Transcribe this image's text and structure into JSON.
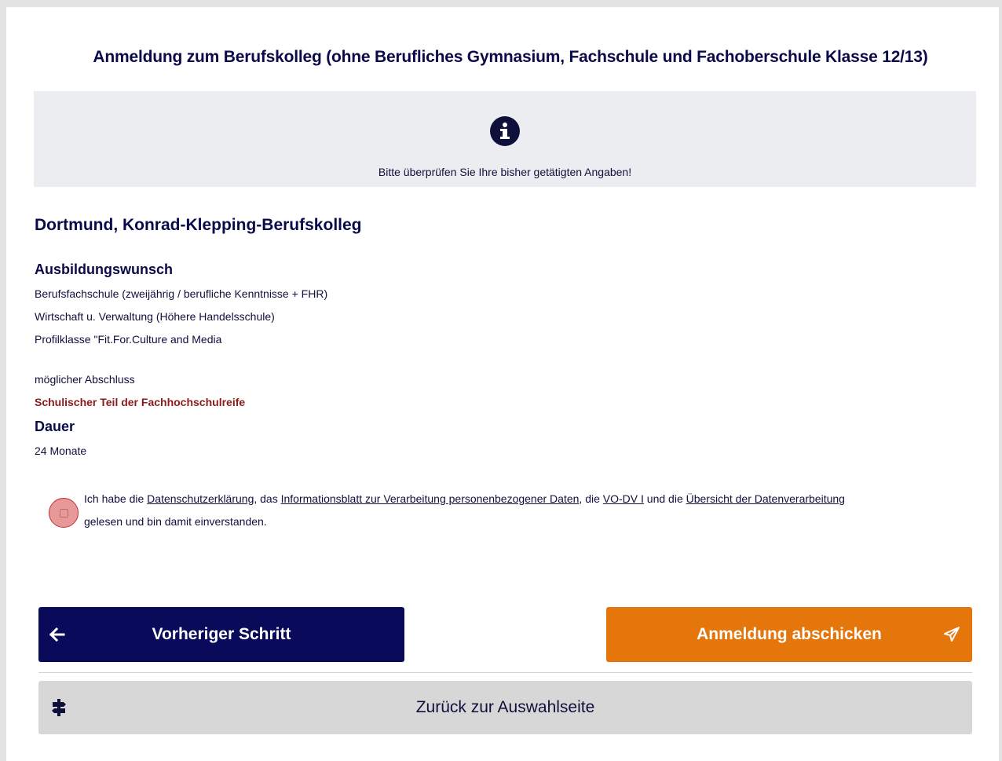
{
  "page": {
    "title": "Anmeldung zum Berufskolleg (ohne Berufliches Gymnasium, Fachschule und Fachoberschule Klasse 12/13)"
  },
  "info": {
    "icon": "info-icon",
    "message": "Bitte überprüfen Sie Ihre bisher getätigten Angaben!"
  },
  "school": {
    "name": "Dortmund, Konrad-Klepping-Berufskolleg"
  },
  "ausbildungswunsch": {
    "heading": "Ausbildungswunsch",
    "lines": [
      "Berufsfachschule (zweijährig / berufliche Kenntnisse + FHR)",
      "Wirtschaft u. Verwaltung (Höhere Handelsschule)",
      "Profilklasse \"Fit.For.Culture and Media"
    ]
  },
  "abschluss": {
    "label": "möglicher Abschluss",
    "value": "Schulischer Teil der Fachhochschulreife"
  },
  "dauer": {
    "heading": "Dauer",
    "value": "24 Monate"
  },
  "consent": {
    "checked": false,
    "text_1": "Ich habe die ",
    "link_datenschutz": "Datenschutzerklärung",
    "text_2": ", das ",
    "link_informationsblatt": "Informationsblatt zur Verarbeitung personenbezogener Daten",
    "text_3": ", die ",
    "link_vodv": "VO-DV I",
    "text_4": " und die ",
    "link_uebersicht": "Übersicht der Datenverarbeitung",
    "text_5": "gelesen und bin damit einverstanden."
  },
  "buttons": {
    "previous_label": "Vorheriger Schritt",
    "previous_icon": "arrow-left-icon",
    "submit_label": "Anmeldung abschicken",
    "submit_icon": "paper-plane-icon",
    "back_label": "Zurück zur Auswahlseite",
    "back_icon": "signpost-icon"
  },
  "colors": {
    "primary": "#0a0a5a",
    "submit": "#e5760b",
    "secondary": "#d7d7d7",
    "info_bg": "#ecedf0",
    "highlight_red": "#8b1a1a",
    "checkbox_error": "#e79898"
  }
}
